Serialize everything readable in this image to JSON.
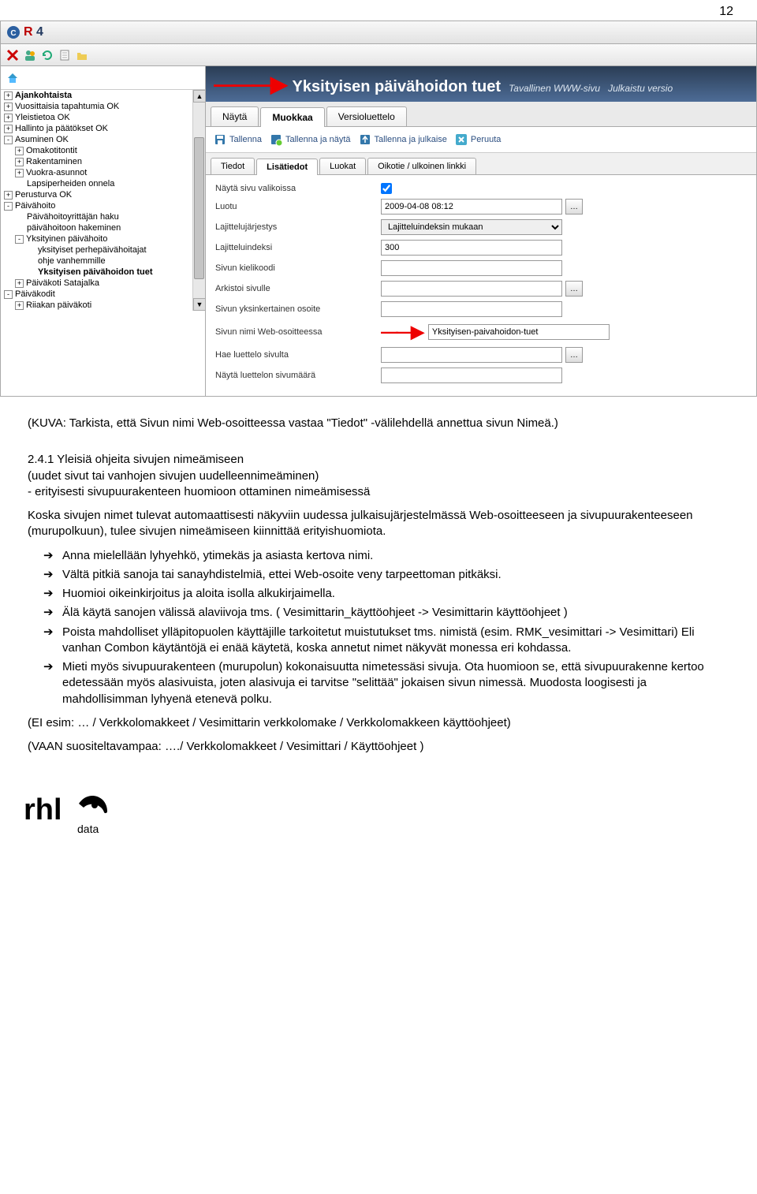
{
  "page_number": "12",
  "app_logo_text": "CR 4",
  "top_title": "Yksityisen päivähoidon tuet",
  "top_subtitle_1": "Tavallinen WWW-sivu",
  "top_subtitle_2": "Julkaistu versio",
  "tabs": {
    "view": "Näytä",
    "edit": "Muokkaa",
    "versions": "Versioluettelo"
  },
  "actions": {
    "save": "Tallenna",
    "save_show": "Tallenna ja näytä",
    "save_publish": "Tallenna ja julkaise",
    "cancel": "Peruuta"
  },
  "subtabs": {
    "tiedot": "Tiedot",
    "lisatiedot": "Lisätiedot",
    "luokat": "Luokat",
    "oikotie": "Oikotie / ulkoinen linkki"
  },
  "form": {
    "show_in_selections": {
      "label": "Näytä sivu valikoissa",
      "checked": true
    },
    "created": {
      "label": "Luotu",
      "value": "2009-04-08 08:12"
    },
    "sort_order": {
      "label": "Lajittelujärjestys",
      "value": "Lajitteluindeksin mukaan"
    },
    "sort_index": {
      "label": "Lajitteluindeksi",
      "value": "300"
    },
    "lang_code": {
      "label": "Sivun kielikoodi",
      "value": ""
    },
    "archive_to": {
      "label": "Arkistoi sivulle",
      "value": ""
    },
    "simple_url": {
      "label": "Sivun yksinkertainen osoite",
      "value": ""
    },
    "web_name": {
      "label": "Sivun nimi Web-osoitteessa",
      "value": "Yksityisen-paivahoidon-tuet"
    },
    "fetch_list": {
      "label": "Hae luettelo sivulta",
      "value": ""
    },
    "show_list_count": {
      "label": "Näytä luettelon sivumäärä",
      "value": ""
    }
  },
  "tree": [
    {
      "label": "Ajankohtaista",
      "toggle": "+",
      "depth": 0,
      "bold": true
    },
    {
      "label": "Vuosittaisia tapahtumia OK",
      "toggle": "+",
      "depth": 0
    },
    {
      "label": "Yleistietoa OK",
      "toggle": "+",
      "depth": 0
    },
    {
      "label": "Hallinto ja päätökset OK",
      "toggle": "+",
      "depth": 0
    },
    {
      "label": "Asuminen OK",
      "toggle": "-",
      "depth": 0
    },
    {
      "label": "Omakotitontit",
      "toggle": "+",
      "depth": 1
    },
    {
      "label": "Rakentaminen",
      "toggle": "+",
      "depth": 1
    },
    {
      "label": "Vuokra-asunnot",
      "toggle": "+",
      "depth": 1
    },
    {
      "label": "Lapsiperheiden onnela",
      "toggle": "",
      "depth": 1
    },
    {
      "label": "Perusturva OK",
      "toggle": "+",
      "depth": 0
    },
    {
      "label": "Päivähoito",
      "toggle": "-",
      "depth": 0
    },
    {
      "label": "Päivähoitoyrittäjän haku",
      "toggle": "",
      "depth": 1
    },
    {
      "label": "päivähoitoon hakeminen",
      "toggle": "",
      "depth": 1
    },
    {
      "label": "Yksityinen päivähoito",
      "toggle": "-",
      "depth": 1
    },
    {
      "label": "yksityiset perhepäivähoitajat",
      "toggle": "",
      "depth": 2
    },
    {
      "label": "ohje vanhemmille",
      "toggle": "",
      "depth": 2
    },
    {
      "label": "Yksityisen päivähoidon tuet",
      "toggle": "",
      "depth": 2,
      "bold": true
    },
    {
      "label": "Päiväkoti Satajalka",
      "toggle": "+",
      "depth": 1
    },
    {
      "label": "Päiväkodit",
      "toggle": "-",
      "depth": 0
    },
    {
      "label": "Riiakan päiväkoti",
      "toggle": "+",
      "depth": 1
    }
  ],
  "doc": {
    "caption": "(KUVA: Tarkista, että Sivun nimi Web-osoitteessa vastaa \"Tiedot\" -välilehdellä annettua sivun Nimeä.)",
    "sec_num": "2.4.1 Yleisiä ohjeita sivujen nimeämiseen",
    "sub_line": "(uudet sivut tai vanhojen sivujen uudelleennimeäminen)",
    "sub_line2": "- erityisesti sivupuurakenteen huomioon ottaminen nimeämisessä",
    "p1": "Koska sivujen nimet tulevat automaattisesti näkyviin uudessa julkaisujärjestelmässä Web-osoitteeseen ja sivupuurakenteeseen (murupolkuun), tulee sivujen nimeämiseen kiinnittää erityishuomiota.",
    "bullets": [
      "Anna mielellään lyhyehkö, ytimekäs ja asiasta kertova nimi.",
      "Vältä pitkiä sanoja tai sanayhdistelmiä, ettei Web-osoite veny tarpeettoman pitkäksi.",
      "Huomioi oikeinkirjoitus ja aloita isolla alkukirjaimella.",
      "Älä käytä sanojen välissä alaviivoja tms.\n( Vesimittarin_käyttöohjeet -> Vesimittarin käyttöohjeet )",
      "Poista mahdolliset ylläpitopuolen käyttäjille tarkoitetut muistutukset tms. nimistä (esim. RMK_vesimittari -> Vesimittari) Eli vanhan Combon käytäntöjä ei enää käytetä, koska annetut nimet näkyvät monessa eri kohdassa.",
      "Mieti myös sivupuurakenteen (murupolun) kokonaisuutta nimetessäsi sivuja. Ota huomioon se, että sivupuurakenne kertoo edetessään myös alasivuista, joten alasivuja ei tarvitse \"selittää\" jokaisen sivun nimessä. Muodosta loogisesti ja mahdollisimman lyhyenä etenevä polku."
    ],
    "ex1": "(EI esim: … / Verkkolomakkeet / Vesimittarin verkkolomake / Verkkolomakkeen käyttöohjeet)",
    "ex2": "(VAAN suositeltavampaa: …./ Verkkolomakkeet / Vesimittari / Käyttöohjeet )"
  }
}
